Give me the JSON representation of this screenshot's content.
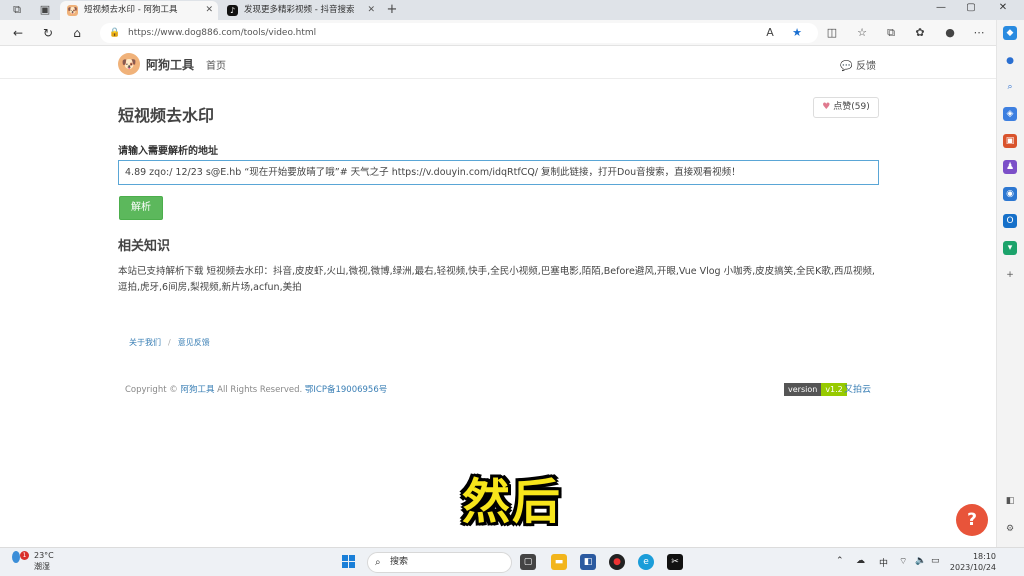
{
  "browser": {
    "tabs": [
      {
        "title": "短视频去水印 - 阿狗工具",
        "active": true,
        "icon": "dog-favicon"
      },
      {
        "title": "发现更多精彩视频 - 抖音搜索",
        "active": false,
        "icon": "tiktok-favicon"
      }
    ],
    "new_tab_glyph": "+",
    "url": "https://www.dog886.com/tools/video.html"
  },
  "site": {
    "logo_text": "阿狗工具",
    "nav_home": "首页",
    "feedback": "反馈"
  },
  "main": {
    "title": "短视频去水印",
    "like_label": "点赞(59)",
    "input_label": "请输入需要解析的地址",
    "input_value": "4.89 zqo:/ 12/23 s@E.hb  “现在开始要放晴了哦”# 天气之子  https://v.douyin.com/idqRtfCQ/ 复制此链接，打开Dou音搜索，直接观看视频！",
    "parse_button": "解析",
    "related_title": "相关知识",
    "related_text": "本站已支持解析下载 短视频去水印：抖音,皮皮虾,火山,微视,微博,绿洲,最右,轻视频,快手,全民小视频,巴塞电影,陌陌,Before避风,开眼,Vue Vlog 小咖秀,皮皮搞笑,全民K歌,西瓜视频,逗拍,虎牙,6间房,梨视频,新片场,acfun,美拍"
  },
  "footer": {
    "about": "关于我们",
    "feedback": "意见反馈",
    "copyright_prefix": "Copyright ©",
    "copyright_site": "阿狗工具",
    "copyright_suffix": "All Rights Reserved.",
    "icp": "鄂ICP备19006956号",
    "version_label": "version",
    "version_value": "v1.2",
    "upyun": "又拍云"
  },
  "help_button": "?",
  "subtitle": "然后",
  "taskbar": {
    "weather_temp": "23°C",
    "weather_desc": "潮湿",
    "weather_badge": "1",
    "search": "搜索",
    "ime": "中",
    "time": "18:10",
    "date": "2023/10/24"
  },
  "colors": {
    "accent_green": "#5cb85c",
    "link_blue": "#3a7fb5",
    "subtitle_yellow": "#f7e51b",
    "help_red": "#e8543a"
  }
}
